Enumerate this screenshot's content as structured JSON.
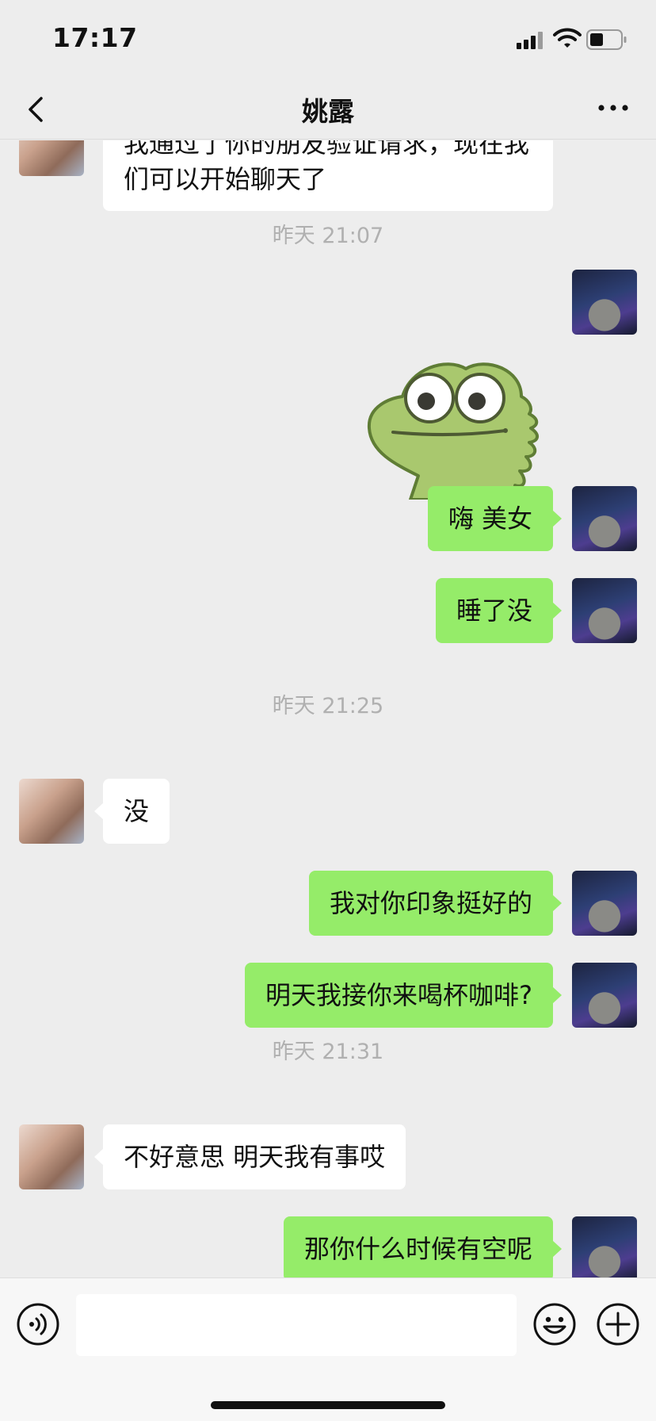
{
  "status_bar": {
    "time": "17:17"
  },
  "nav": {
    "title": "姚露"
  },
  "chat": {
    "first_message": "我通过了你的朋友验证请求，现在我们可以开始聊天了",
    "timestamps": [
      "昨天 21:07",
      "昨天 21:25",
      "昨天 21:31"
    ],
    "sticker": "green-dinosaur-sticker",
    "messages": [
      {
        "from": "me",
        "text": "嗨 美女"
      },
      {
        "from": "me",
        "text": "睡了没"
      },
      {
        "from": "her",
        "text": "没"
      },
      {
        "from": "me",
        "text": "我对你印象挺好的"
      },
      {
        "from": "me",
        "text": "明天我接你来喝杯咖啡?"
      },
      {
        "from": "her",
        "text": "不好意思 明天我有事哎"
      },
      {
        "from": "me",
        "text": "那你什么时候有空呢"
      }
    ]
  },
  "input": {
    "value": ""
  },
  "icons": [
    "back-arrow-icon",
    "more-icon",
    "voice-icon",
    "emoji-icon",
    "plus-icon"
  ],
  "colors": {
    "background": "#ededed",
    "my_bubble": "#95ec69",
    "her_bubble": "#ffffff",
    "timestamp": "#b0b0b0"
  }
}
